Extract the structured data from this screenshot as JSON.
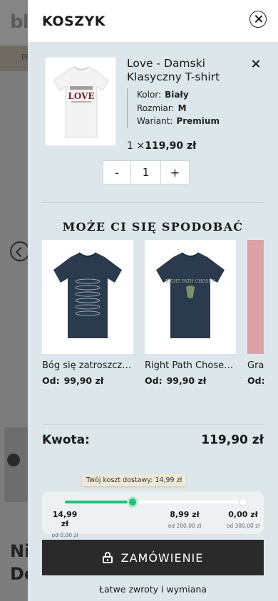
{
  "background": {
    "logo": "bl",
    "nav_text": "Pi",
    "heading": "Ni\nDe"
  },
  "cart": {
    "title": "KOSZYK",
    "item": {
      "name": "Love - Damski Klasyczny T-shirt",
      "shirt_print_text": "LOVE",
      "attributes": [
        {
          "label": "Kolor:",
          "value": "Biały"
        },
        {
          "label": "Rozmiar:",
          "value": "M"
        },
        {
          "label": "Wariant:",
          "value": "Premium"
        }
      ],
      "quantity_prefix": "1 ×",
      "price": "119,90 zł",
      "quantity": "1",
      "minus_label": "-",
      "plus_label": "+"
    },
    "recommendations": {
      "title": "MOŻE CI SIĘ SPODOBAĆ",
      "items": [
        {
          "name": "Bóg się zatroszczy…",
          "price_prefix": "Od:",
          "price": "99,90 zł"
        },
        {
          "name": "Right Path Chose…",
          "price_prefix": "Od:",
          "price": "99,90 zł",
          "print_text": "RIGHT PATH CHOSEN"
        },
        {
          "name": "Gra",
          "price_prefix": "Od:",
          "price": ""
        }
      ]
    },
    "total": {
      "label": "Kwota:",
      "value": "119,90 zł"
    },
    "shipping": {
      "tooltip": "Twój koszt dostawy: 14,99 zł",
      "progress_fraction": 0.38,
      "tiers": [
        {
          "price": "14,99 zł",
          "min": "od 0,00 zł"
        },
        {
          "price": "8,99 zł",
          "min": "od 200,00 zł"
        },
        {
          "price": "0,00 zł",
          "min": "od 300,00 zł"
        }
      ]
    },
    "order_button": "ZAMÓWIENIE",
    "returns_text": "Łatwe zwroty i wymiana"
  },
  "colors": {
    "drawer_bg": "#dde6ea",
    "accent_green": "#1cc27a",
    "button_dark": "#2a2a2a",
    "shirt_navy": "#2c3a4e"
  }
}
